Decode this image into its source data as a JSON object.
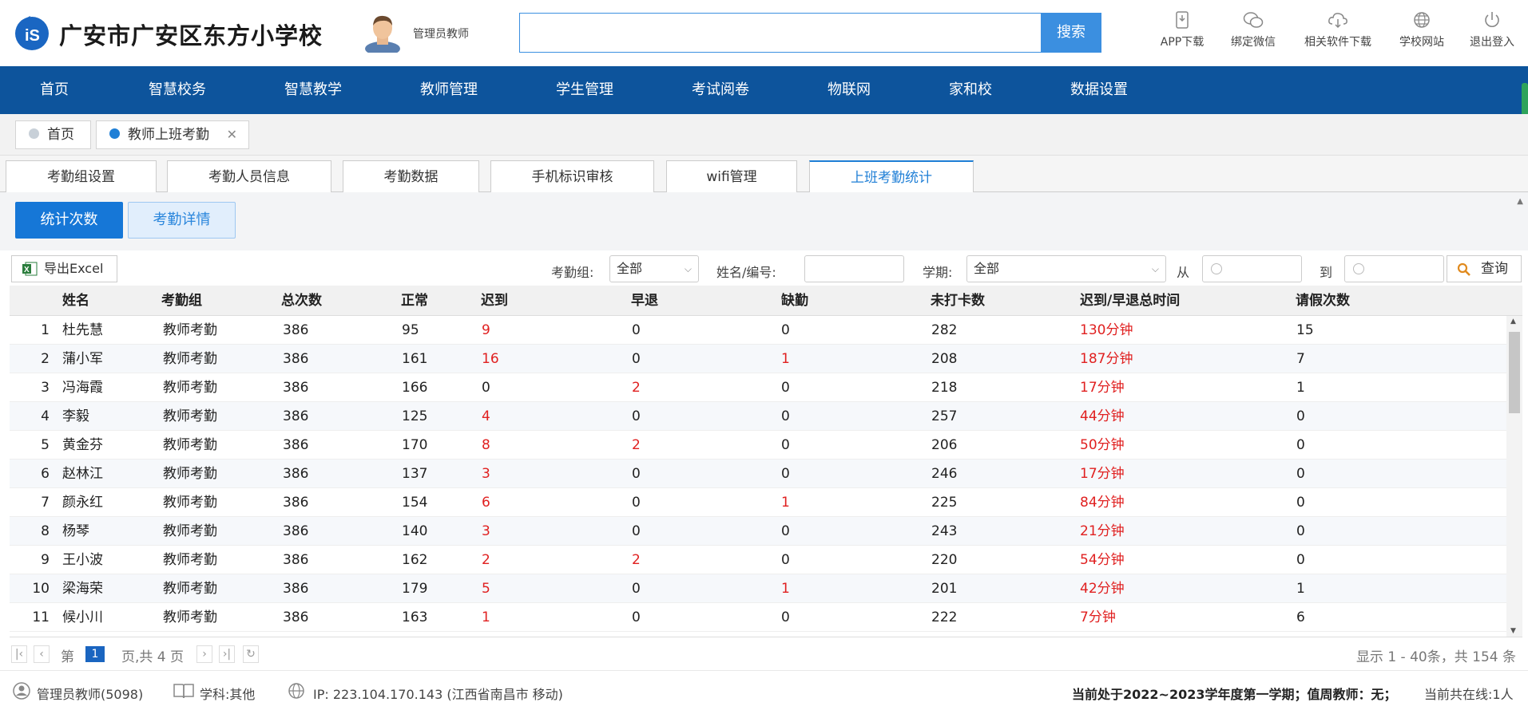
{
  "header": {
    "school_name": "广安市广安区东方小学校",
    "user_label": "管理员教师",
    "search": {
      "value": "",
      "button": "搜索"
    },
    "icons": [
      {
        "name": "phone-download-icon",
        "label": "APP下载"
      },
      {
        "name": "wechat-icon",
        "label": "绑定微信"
      },
      {
        "name": "cloud-download-icon",
        "label": "相关软件下载"
      },
      {
        "name": "globe-icon",
        "label": "学校网站"
      },
      {
        "name": "power-icon",
        "label": "退出登入"
      }
    ]
  },
  "nav": [
    "首页",
    "智慧校务",
    "智慧教学",
    "教师管理",
    "学生管理",
    "考试阅卷",
    "物联网",
    "家和校",
    "数据设置"
  ],
  "crumbs": [
    {
      "label": "首页",
      "dot_color": "#c8d0d8"
    },
    {
      "label": "教师上班考勤",
      "dot_color": "#1f7fd6",
      "close": "✕"
    }
  ],
  "subtabs": [
    "考勤组设置",
    "考勤人员信息",
    "考勤数据",
    "手机标识审核",
    "wifi管理",
    "上班考勤统计"
  ],
  "active_subtab": "上班考勤统计",
  "toggles": {
    "primary": "统计次数",
    "secondary": "考勤详情"
  },
  "filters": {
    "export": "导出Excel",
    "group_label": "考勤组:",
    "group_value": "全部",
    "name_label": "姓名/编号:",
    "name_value": "",
    "term_label": "学期:",
    "term_value": "全部",
    "from_label": "从",
    "to_label": "到",
    "query": "查询"
  },
  "table": {
    "headers": [
      "姓名",
      "考勤组",
      "总次数",
      "正常",
      "迟到",
      "早退",
      "缺勤",
      "未打卡数",
      "迟到/早退总时间",
      "请假次数"
    ],
    "rows": [
      [
        "1",
        "杜先慧",
        "教师考勤",
        "386",
        "95",
        "9",
        "0",
        "0",
        "282",
        "130分钟",
        "15"
      ],
      [
        "2",
        "蒲小军",
        "教师考勤",
        "386",
        "161",
        "16",
        "0",
        "1",
        "208",
        "187分钟",
        "7"
      ],
      [
        "3",
        "冯海霞",
        "教师考勤",
        "386",
        "166",
        "0",
        "2",
        "0",
        "218",
        "17分钟",
        "1"
      ],
      [
        "4",
        "李毅",
        "教师考勤",
        "386",
        "125",
        "4",
        "0",
        "0",
        "257",
        "44分钟",
        "0"
      ],
      [
        "5",
        "黄金芬",
        "教师考勤",
        "386",
        "170",
        "8",
        "2",
        "0",
        "206",
        "50分钟",
        "0"
      ],
      [
        "6",
        "赵林江",
        "教师考勤",
        "386",
        "137",
        "3",
        "0",
        "0",
        "246",
        "17分钟",
        "0"
      ],
      [
        "7",
        "颜永红",
        "教师考勤",
        "386",
        "154",
        "6",
        "0",
        "1",
        "225",
        "84分钟",
        "0"
      ],
      [
        "8",
        "杨琴",
        "教师考勤",
        "386",
        "140",
        "3",
        "0",
        "0",
        "243",
        "21分钟",
        "0"
      ],
      [
        "9",
        "王小波",
        "教师考勤",
        "386",
        "162",
        "2",
        "2",
        "0",
        "220",
        "54分钟",
        "0"
      ],
      [
        "10",
        "梁海荣",
        "教师考勤",
        "386",
        "179",
        "5",
        "0",
        "1",
        "201",
        "42分钟",
        "1"
      ],
      [
        "11",
        "候小川",
        "教师考勤",
        "386",
        "163",
        "1",
        "0",
        "0",
        "222",
        "7分钟",
        "6"
      ]
    ]
  },
  "pager": {
    "page_prefix": "第",
    "page": "1",
    "page_suffix": "页,共 4 页",
    "info": "显示 1 - 40条，共 154 条"
  },
  "status": {
    "user": "管理员教师(5098)",
    "subject": "学科:其他",
    "ip": "IP:  223.104.170.143 (江西省南昌市 移动)",
    "term": "当前处于2022~2023学年度第一学期；值周教师：无；",
    "online": "当前共在线:1人"
  },
  "colors": {
    "nav_bg": "#0d549c",
    "accent": "#1677d7",
    "alert_red": "#e02020"
  }
}
